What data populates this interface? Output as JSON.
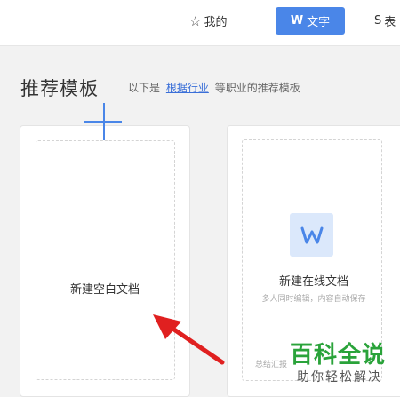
{
  "nav": {
    "mine_label": "我的",
    "doc_label": "文字",
    "doc_glyph": "W",
    "sheet_glyph": "S",
    "sheet_label_partial": "表",
    "active_color": "#4a86e8"
  },
  "section": {
    "title": "推荐模板",
    "subtitle_prefix": "以下是",
    "subtitle_link": "根据行业",
    "subtitle_suffix": "等职业的推荐模板"
  },
  "cards": {
    "blank": {
      "label": "新建空白文档",
      "icon": "plus-icon"
    },
    "online": {
      "title": "新建在线文档",
      "subtitle": "多人同时编辑，内容自动保存",
      "footer_partial": "总结汇报",
      "icon": "w-doc-icon"
    }
  },
  "watermark": {
    "main": "百科全说",
    "sub": "助你轻松解决",
    "color": "#2aa33a"
  },
  "annotation": {
    "arrow_color": "#e02020",
    "icon": "red-arrow-icon"
  }
}
